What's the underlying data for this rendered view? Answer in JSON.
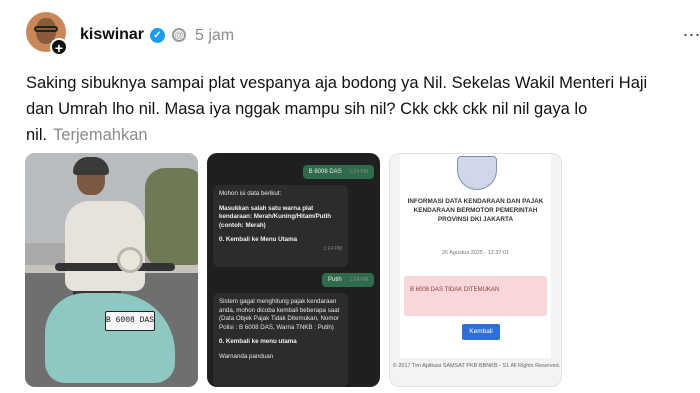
{
  "post": {
    "username": "kiswinar",
    "time": "5 jam",
    "text": "Saking sibuknya sampai plat vespanya aja bodong ya Nil. Sekelas Wakil Menteri Haji dan Umrah lho nil. Masa iya nggak mampu sih nil? Ckk ckk ckk nil nil gaya lo nil.",
    "translate": "Terjemahkan",
    "more": "...",
    "avatar_badge": "+",
    "verified_mark": "✓"
  },
  "photo": {
    "plate": "B 6008 DAS"
  },
  "chat": {
    "msg1": "B 6008 DAS",
    "msg1_time": "1:24 PM",
    "bot1_intro": "Mohon isi data berikut:",
    "bot1_body": "Masukkan salah satu warna plat kendaraan: Merah/Kuning/Hitam/Putih (contoh: Merah)",
    "bot1_menu": "0. Kembali ke Menu Utama",
    "bot1_time": "1:24 PM",
    "msg2": "Putih",
    "msg2_time": "1:24 PM",
    "bot2_body": "Sistem gagal menghitung pajak kendaraan anda, mohon dicoba kembali beberapa saat (Data Objek Pajak Tidak Ditemukan, Nomor Polisi : B 6008 DAS, Warna TNKB : Putih)",
    "bot2_menu": "0. Kembali ke menu utama",
    "bot2_footer": "Warnanda panduan"
  },
  "info": {
    "title": "INFORMASI DATA KENDARAAN DAN PAJAK KENDARAAN BERMOTOR PEMERINTAH PROVINSI DKI JAKARTA",
    "date": "26 Agustus 2025 - 12:37:01",
    "notice": "B 6008 DAS TIDAK DITEMUKAN",
    "button": "Kembali",
    "copyright": "© 2017 Tim Aplikasi SAMSAT PKB BBNKB - S1 All Rights Reserved."
  },
  "icons": {
    "verified": "verified-badge-icon",
    "threads": "threads-icon",
    "more": "more-options-icon"
  },
  "colors": {
    "verified": "#1d9bf0",
    "chat_bg": "#1f1f1f",
    "chat_out": "#2f6b4a",
    "button": "#2d6fd6",
    "notice_bg": "#f7d7d9"
  }
}
